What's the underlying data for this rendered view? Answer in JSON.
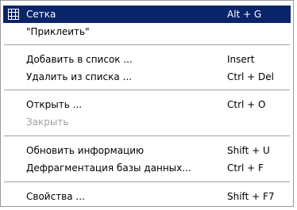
{
  "menu": {
    "items": [
      {
        "label": "Сетка",
        "shortcut": "Alt + G",
        "icon": "grid-icon"
      },
      {
        "label": "\"Приклеить\"",
        "shortcut": ""
      },
      {
        "label": "Добавить в список ...",
        "shortcut": "Insert"
      },
      {
        "label": "Удалить из списка ...",
        "shortcut": "Ctrl + Del"
      },
      {
        "label": "Открыть ...",
        "shortcut": "Ctrl + O"
      },
      {
        "label": "Закрыть",
        "shortcut": ""
      },
      {
        "label": "Обновить информацию",
        "shortcut": "Shift + U"
      },
      {
        "label": "Дефрагментация базы данных...",
        "shortcut": "Ctrl + F"
      },
      {
        "label": "Свойства ...",
        "shortcut": "Shift + F7"
      }
    ],
    "colors": {
      "highlight_bg": "#0a246a",
      "highlight_text": "#ffffff",
      "disabled_text": "#a0a0a0"
    }
  }
}
